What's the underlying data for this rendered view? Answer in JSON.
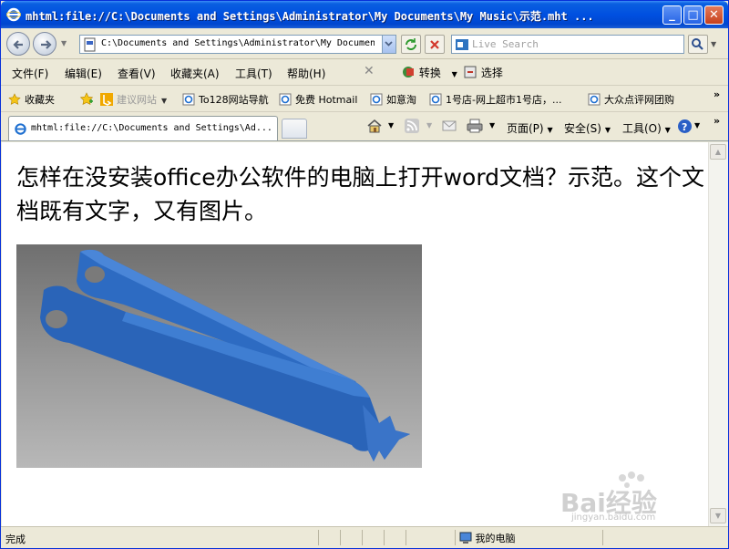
{
  "window": {
    "title": "mhtml:file://C:\\Documents and Settings\\Administrator\\My Documents\\My Music\\示范.mht ..."
  },
  "address": {
    "url": "C:\\Documents and Settings\\Administrator\\My Document",
    "search_placeholder": "Live Search"
  },
  "menu": {
    "items": [
      "文件(F)",
      "编辑(E)",
      "查看(V)",
      "收藏夹(A)",
      "工具(T)",
      "帮助(H)"
    ],
    "convert_label": "转换",
    "select_label": "选择"
  },
  "favorites": {
    "label": "收藏夹",
    "items": [
      "建议网站",
      "To128网站导航",
      "免费 Hotmail",
      "如意淘",
      "1号店-网上超市1号店，...",
      "大众点评网团购"
    ]
  },
  "tab": {
    "title": "mhtml:file://C:\\Documents and Settings\\Ad..."
  },
  "commands": {
    "page_label": "页面(P)",
    "safety_label": "安全(S)",
    "tools_label": "工具(O)"
  },
  "content": {
    "heading": "怎样在没安装office办公软件的电脑上打开word文档？示范。这个文档既有文字，又有图片。"
  },
  "status": {
    "text": "完成",
    "zone": "我的电脑"
  },
  "watermark": {
    "brand": "Bai经验",
    "url": "jingyan.baidu.com"
  },
  "colors": {
    "titlebar": "#0054e3",
    "shape_blue": "#2f6fc4",
    "image_bg": "#8a8a8a"
  }
}
